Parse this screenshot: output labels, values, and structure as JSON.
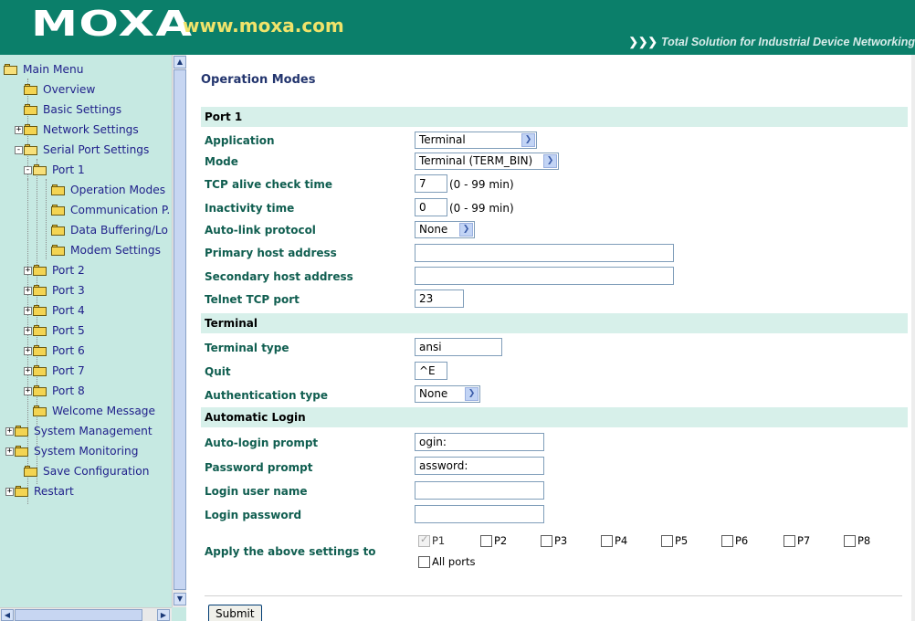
{
  "header": {
    "logo": "MOXA",
    "url": "www.moxa.com",
    "tagline": "Total Solution for Industrial Device Networking"
  },
  "tree": {
    "items": [
      {
        "label": "Main Menu",
        "expander": "",
        "open": true
      },
      {
        "label": "Overview",
        "expander": "",
        "open": false
      },
      {
        "label": "Basic Settings",
        "expander": "",
        "open": false
      },
      {
        "label": "Network Settings",
        "expander": "+",
        "open": false
      },
      {
        "label": "Serial Port Settings",
        "expander": "-",
        "open": true
      },
      {
        "label": "Port 1",
        "expander": "-",
        "open": true
      },
      {
        "label": "Operation Modes",
        "expander": "",
        "open": false
      },
      {
        "label": "Communication P.",
        "expander": "",
        "open": false
      },
      {
        "label": "Data Buffering/Lo",
        "expander": "",
        "open": false
      },
      {
        "label": "Modem Settings",
        "expander": "",
        "open": false
      },
      {
        "label": "Port 2",
        "expander": "+",
        "open": false
      },
      {
        "label": "Port 3",
        "expander": "+",
        "open": false
      },
      {
        "label": "Port 4",
        "expander": "+",
        "open": false
      },
      {
        "label": "Port 5",
        "expander": "+",
        "open": false
      },
      {
        "label": "Port 6",
        "expander": "+",
        "open": false
      },
      {
        "label": "Port 7",
        "expander": "+",
        "open": false
      },
      {
        "label": "Port 8",
        "expander": "+",
        "open": false
      },
      {
        "label": "Welcome Message",
        "expander": "",
        "open": false
      },
      {
        "label": "System Management",
        "expander": "+",
        "open": false
      },
      {
        "label": "System Monitoring",
        "expander": "+",
        "open": false
      },
      {
        "label": "Save Configuration",
        "expander": "",
        "open": false
      },
      {
        "label": "Restart",
        "expander": "+",
        "open": false
      }
    ]
  },
  "main": {
    "title": "Operation Modes",
    "sections": {
      "port1": "Port 1",
      "terminal": "Terminal",
      "automatic_login": "Automatic Login"
    },
    "fields": {
      "application": {
        "label": "Application",
        "value": "Terminal"
      },
      "mode": {
        "label": "Mode",
        "value": "Terminal (TERM_BIN)"
      },
      "tcp_alive": {
        "label": "TCP alive check time",
        "value": "7",
        "hint": "(0 - 99 min)"
      },
      "inactivity": {
        "label": "Inactivity time",
        "value": "0",
        "hint": "(0 - 99 min)"
      },
      "auto_link": {
        "label": "Auto-link protocol",
        "value": "None"
      },
      "primary_host": {
        "label": "Primary host address",
        "value": ""
      },
      "secondary_host": {
        "label": "Secondary host address",
        "value": ""
      },
      "telnet_port": {
        "label": "Telnet TCP port",
        "value": "23"
      },
      "terminal_type": {
        "label": "Terminal type",
        "value": "ansi"
      },
      "quit": {
        "label": "Quit",
        "value": "^E"
      },
      "auth_type": {
        "label": "Authentication type",
        "value": "None"
      },
      "auto_login_prompt": {
        "label": "Auto-login prompt",
        "value": "ogin:"
      },
      "password_prompt": {
        "label": "Password prompt",
        "value": "assword:"
      },
      "login_user": {
        "label": "Login user name",
        "value": ""
      },
      "login_password": {
        "label": "Login password",
        "value": ""
      }
    },
    "apply": {
      "label": "Apply the above settings to",
      "ports": [
        {
          "label": "P1",
          "checked": true,
          "disabled": true
        },
        {
          "label": "P2",
          "checked": false
        },
        {
          "label": "P3",
          "checked": false
        },
        {
          "label": "P4",
          "checked": false
        },
        {
          "label": "P5",
          "checked": false
        },
        {
          "label": "P6",
          "checked": false
        },
        {
          "label": "P7",
          "checked": false
        },
        {
          "label": "P8",
          "checked": false
        }
      ],
      "all_ports": "All ports"
    },
    "submit": "Submit"
  },
  "colors": {
    "header_bg": "#0b7f6a",
    "url": "#f0e36a",
    "tree_bg": "#c6e9e2",
    "section_bg": "#d7f0ea",
    "label": "#105e50",
    "title": "#23356e"
  }
}
